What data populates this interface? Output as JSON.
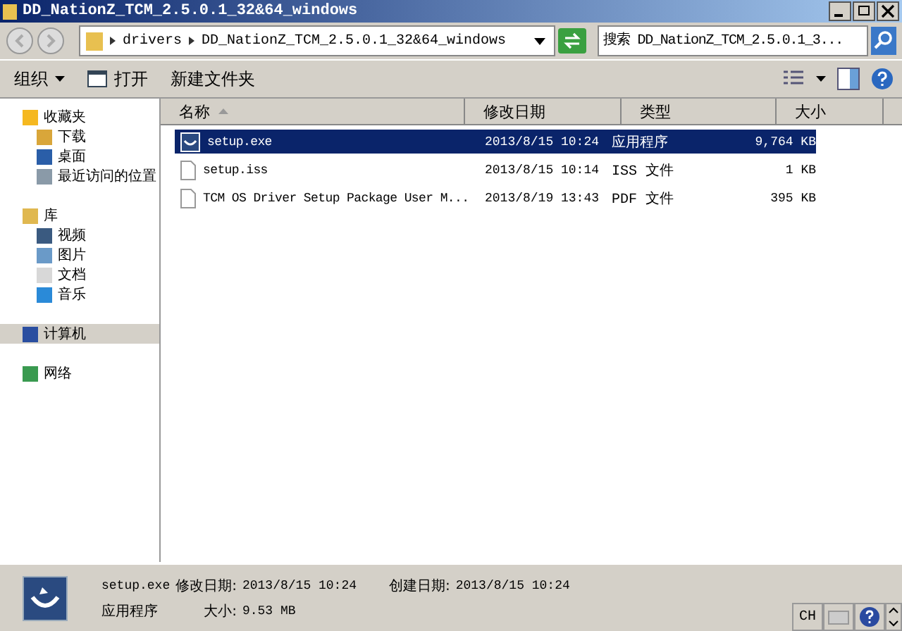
{
  "window": {
    "title": "DD_NationZ_TCM_2.5.0.1_32&64_windows"
  },
  "address": {
    "breadcrumbs": [
      "drivers",
      "DD_NationZ_TCM_2.5.0.1_32&64_windows"
    ]
  },
  "search": {
    "placeholder": "搜索 DD_NationZ_TCM_2.5.0.1_3..."
  },
  "toolbar": [
    {
      "label": "组织",
      "kind": "menu"
    },
    {
      "label": "打开",
      "kind": "open"
    },
    {
      "label": "新建文件夹",
      "kind": "plain"
    }
  ],
  "sidebar": {
    "groups": [
      {
        "label": "收藏夹",
        "kind": "star",
        "selected": false,
        "children": [
          {
            "label": "下载",
            "kind": "download"
          },
          {
            "label": "桌面",
            "kind": "desktop"
          },
          {
            "label": "最近访问的位置",
            "kind": "recent"
          }
        ]
      },
      {
        "label": "库",
        "kind": "library",
        "selected": false,
        "children": [
          {
            "label": "视频",
            "kind": "video"
          },
          {
            "label": "图片",
            "kind": "picture"
          },
          {
            "label": "文档",
            "kind": "doc"
          },
          {
            "label": "音乐",
            "kind": "music"
          }
        ]
      },
      {
        "label": "计算机",
        "kind": "computer",
        "selected": true
      },
      {
        "label": "网络",
        "kind": "network",
        "selected": false
      }
    ]
  },
  "columns": [
    {
      "label": "名称",
      "sorted": true
    },
    {
      "label": "修改日期",
      "sorted": false
    },
    {
      "label": "类型",
      "sorted": false
    },
    {
      "label": "大小",
      "sorted": false
    }
  ],
  "rows": [
    {
      "name": "setup.exe",
      "date": "2013/8/15 10:24",
      "type": "应用程序",
      "size": "9,764 KB",
      "kind": "app",
      "selected": true
    },
    {
      "name": "setup.iss",
      "date": "2013/8/15 10:14",
      "type": "ISS 文件",
      "size": "1 KB",
      "kind": "file",
      "selected": false
    },
    {
      "name": "TCM OS Driver Setup Package User M...",
      "date": "2013/8/19 13:43",
      "type": "PDF 文件",
      "size": "395 KB",
      "kind": "file",
      "selected": false
    }
  ],
  "details": {
    "name": "setup.exe",
    "modified_label": "修改日期:",
    "modified": "2013/8/15 10:24",
    "created_label": "创建日期:",
    "created": "2013/8/15 10:24",
    "type": "应用程序",
    "size_label": "大小:",
    "size": "9.53 MB"
  },
  "language_bar": {
    "language": "CH"
  }
}
